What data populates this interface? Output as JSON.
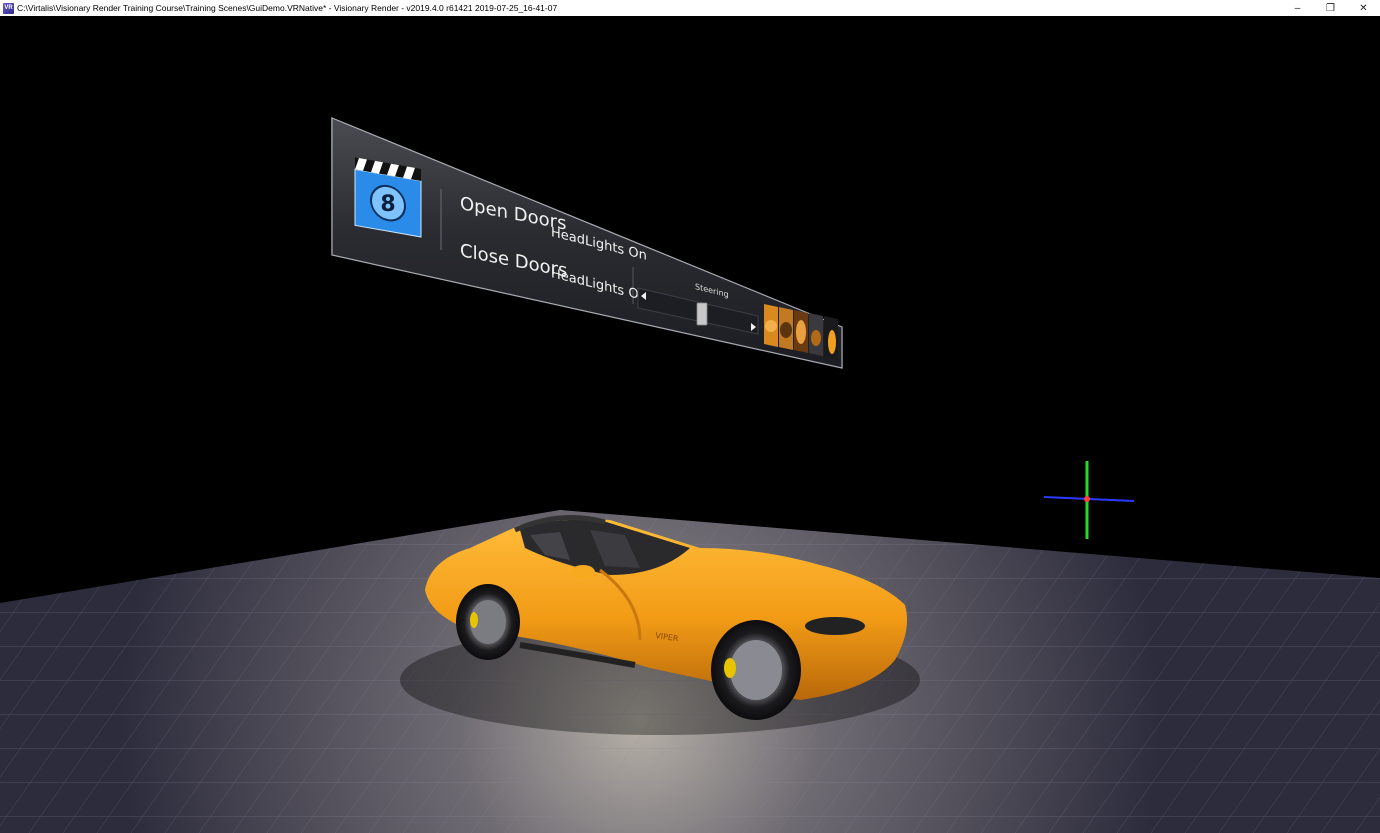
{
  "window": {
    "title": "C:\\Virtalis\\Visionary Render Training Course\\Training Scenes\\GuiDemo.VRNative* - Visionary Render - v2019.4.0 r61421 2019-07-25_16-41-07",
    "app_icon_text": "VR",
    "controls": {
      "minimize": "–",
      "restore": "❐",
      "close": "✕"
    }
  },
  "vr_menu": {
    "icon": "clapperboard-icon",
    "icon_number": "8",
    "open_doors": "Open Doors",
    "close_doors": "Close Doors",
    "headlights_on": "HeadLights On",
    "headlights_off": "HeadLights Off",
    "steering_label": "Steering",
    "material_swatches": [
      "swatch-orange",
      "swatch-tan",
      "swatch-dark-orange",
      "swatch-gray",
      "swatch-yellow"
    ]
  },
  "scene": {
    "car_color": "#f2a11e",
    "floor_color": "#3b3a4d",
    "gizmo_colors": {
      "x": "#2a3bff",
      "y": "#22dd22"
    }
  }
}
